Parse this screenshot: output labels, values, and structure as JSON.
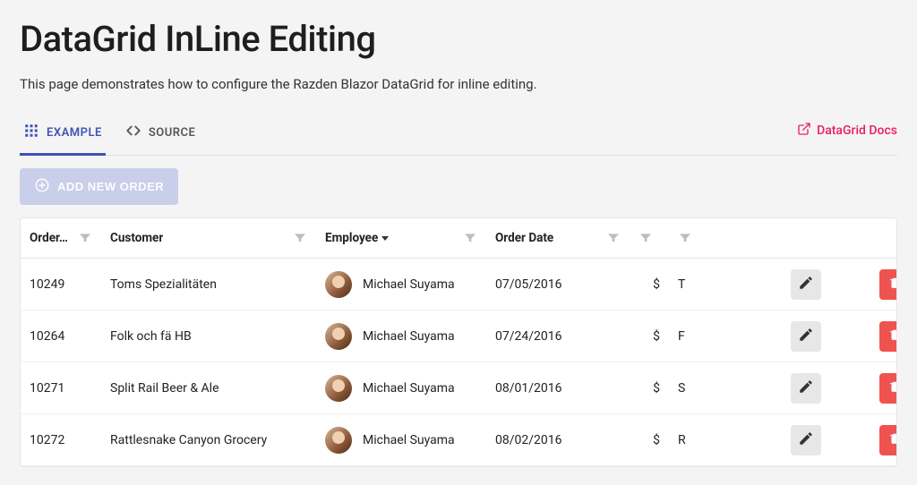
{
  "title": "DataGrid InLine Editing",
  "subtitle": "This page demonstrates how to configure the Razden Blazor DataGrid for inline editing.",
  "tabs": {
    "example": "Example",
    "source": "Source"
  },
  "docs_link": "DataGrid Docs",
  "add_button": "Add New Order",
  "columns": {
    "order": "Order…",
    "customer": "Customer",
    "employee": "Employee",
    "order_date": "Order Date"
  },
  "rows": [
    {
      "order_id": "10249",
      "customer": "Toms Spezialitäten",
      "employee": "Michael Suyama",
      "order_date": "07/05/2016",
      "currency": "$",
      "ship": "T"
    },
    {
      "order_id": "10264",
      "customer": "Folk och fä HB",
      "employee": "Michael Suyama",
      "order_date": "07/24/2016",
      "currency": "$",
      "ship": "F"
    },
    {
      "order_id": "10271",
      "customer": "Split Rail Beer & Ale",
      "employee": "Michael Suyama",
      "order_date": "08/01/2016",
      "currency": "$",
      "ship": "S"
    },
    {
      "order_id": "10272",
      "customer": "Rattlesnake Canyon Grocery",
      "employee": "Michael Suyama",
      "order_date": "08/02/2016",
      "currency": "$",
      "ship": "R"
    }
  ]
}
